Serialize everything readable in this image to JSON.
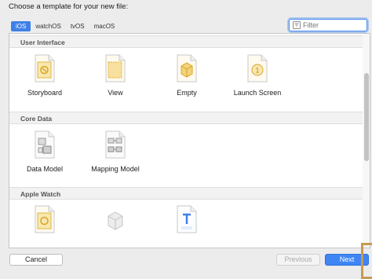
{
  "dialog": {
    "title": "Choose a template for your new file:"
  },
  "platform_tabs": [
    {
      "label": "iOS",
      "selected": true
    },
    {
      "label": "watchOS",
      "selected": false
    },
    {
      "label": "tvOS",
      "selected": false
    },
    {
      "label": "macOS",
      "selected": false
    }
  ],
  "filter": {
    "placeholder": "Filter"
  },
  "sections": [
    {
      "header": "User Interface",
      "items": [
        {
          "label": "Storyboard",
          "icon": "storyboard-icon"
        },
        {
          "label": "View",
          "icon": "view-icon"
        },
        {
          "label": "Empty",
          "icon": "empty-icon"
        },
        {
          "label": "Launch Screen",
          "icon": "launch-screen-icon"
        }
      ]
    },
    {
      "header": "Core Data",
      "items": [
        {
          "label": "Data Model",
          "icon": "data-model-icon"
        },
        {
          "label": "Mapping Model",
          "icon": "mapping-model-icon"
        }
      ]
    },
    {
      "header": "Apple Watch",
      "items": [
        {
          "label": "",
          "icon": "watch-storyboard-icon"
        },
        {
          "label": "",
          "icon": "watch-asset-icon"
        },
        {
          "label": "",
          "icon": "notification-payload-icon"
        }
      ]
    }
  ],
  "buttons": {
    "cancel": "Cancel",
    "previous": "Previous",
    "next": "Next"
  },
  "colors": {
    "accent": "#3f80e8",
    "template_gold": "#e2b73c"
  }
}
